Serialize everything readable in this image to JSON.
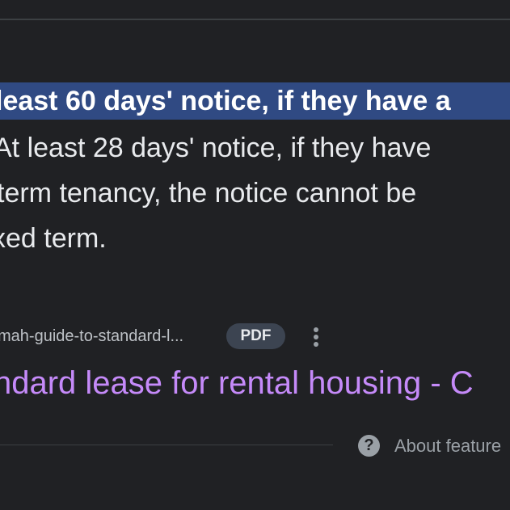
{
  "snippet": {
    "line1": "least 60 days' notice, if they have a",
    "line2": "At least 28 days' notice, if they have",
    "line3": " term tenancy, the notice cannot be",
    "line4": "xed term."
  },
  "source": {
    "url": "mah-guide-to-standard-l...",
    "badge": "PDF",
    "more_icon": "more-vert-icon"
  },
  "result": {
    "title": "ndard lease for rental housing - C"
  },
  "footer": {
    "help_icon": "help-icon",
    "help_glyph": "?",
    "about_text": "About feature"
  },
  "colors": {
    "background": "#202124",
    "highlight": "#304a83",
    "link": "#c58af9",
    "badge_bg": "#3c4451"
  }
}
